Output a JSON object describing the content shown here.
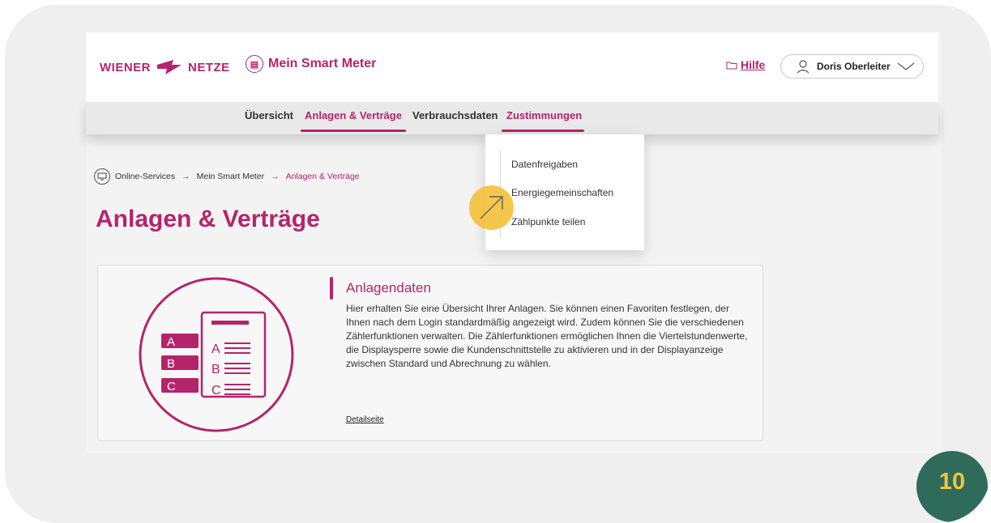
{
  "header": {
    "logo_left": "WIENER",
    "logo_right": "NETZE",
    "product_name": "Mein Smart Meter",
    "help_label": "Hilfe",
    "user_name": "Doris Oberleiter"
  },
  "nav": {
    "items": [
      {
        "label": "Übersicht",
        "active": false
      },
      {
        "label": "Anlagen & Verträge",
        "active": true
      },
      {
        "label": "Verbrauchsdaten",
        "active": false
      },
      {
        "label": "Zustimmungen",
        "active": true
      }
    ]
  },
  "dropdown": {
    "items": [
      "Datenfreigaben",
      "Energiegemeinschaften",
      "Zählpunkte teilen"
    ]
  },
  "breadcrumb": {
    "items": [
      "Online-Services",
      "Mein Smart Meter",
      "Anlagen & Verträge"
    ]
  },
  "page": {
    "title": "Anlagen & Verträge"
  },
  "card": {
    "title": "Anlagendaten",
    "text": "Hier erhalten Sie eine Übersicht Ihrer Anlagen. Sie können einen Favoriten festlegen, der Ihnen nach dem Login standardmäßig angezeigt wird. Zudem können Sie die verschiedenen Zählerfunktionen verwalten. Die Zählerfunktionen ermöglichen Ihnen die Viertelstundenwerte, die Displaysperre sowie die Kundenschnittstelle zu aktivieren und in der Displayanzeige zwischen Standard und Abrechnung zu wählen.",
    "link": "Detailseite",
    "illustration_letters": [
      "A",
      "B",
      "C"
    ]
  },
  "step_badge": "10",
  "colors": {
    "brand": "#b5246b",
    "highlight": "#f4c23c",
    "badge": "#2f6b5b"
  }
}
